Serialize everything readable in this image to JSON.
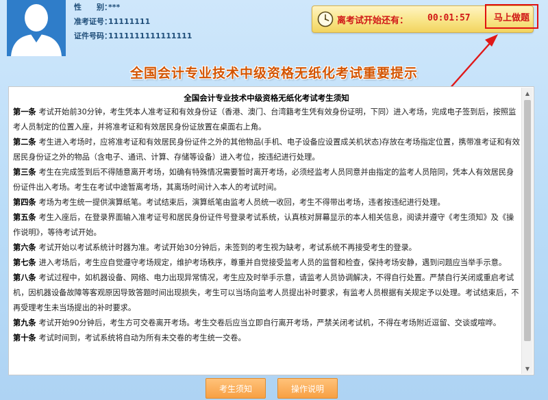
{
  "candidate": {
    "gender_label": "性　　别：",
    "gender_value": "***",
    "ticket_label": "准考证号：",
    "ticket_value": "11111111",
    "id_label": "证件号码：",
    "id_value": "1111111111111111"
  },
  "timer": {
    "label": "离考试开始还有：",
    "value": "00:01:57",
    "start_button": "马上做题",
    "icon": "clock-icon"
  },
  "banner": "全国会计专业技术中级资格无纸化考试重要提示",
  "notice": {
    "title": "全国会计专业技术中级资格无纸化考试考生须知",
    "rules": [
      {
        "head": "第一条",
        "text": "考试开始前30分钟，考生凭本人准考证和有效身份证（香港、澳门、台湾籍考生凭有效身份证明，下同）进入考场，完成电子签到后，按照监考人员制定的位置入座，并将准考证和有效居民身份证放置在桌面右上角。"
      },
      {
        "head": "第二条",
        "text": "考生进入考场时，应将准考证和有效居民身份证件之外的其他物品(手机、电子设备应设置成关机状态)存放在考场指定位置，携带准考证和有效居民身份证之外的物品（含电子、通讯、计算、存储等设备）进入考位，按违纪进行处理。"
      },
      {
        "head": "第三条",
        "text": "考生在完成签到后不得随意离开考场，如确有特殊情况需要暂时离开考场，必须经监考人员同意并由指定的监考人员陪同，凭本人有效居民身份证件出入考场。考生在考试中途暂离考场，其离场时间计入本人的考试时间。"
      },
      {
        "head": "第四条",
        "text": "考场为考生统一提供演算纸笔。考试结束后，演算纸笔由监考人员统一收回，考生不得带出考场，违者按违纪进行处理。"
      },
      {
        "head": "第五条",
        "text": "考生入座后，在登录界面输入准考证号和居民身份证件号登录考试系统，认真核对屏幕显示的本人相关信息，阅读并遵守《考生须知》及《操作说明》，等待考试开始。"
      },
      {
        "head": "第六条",
        "text": "考试开始以考试系统计时器为准。考试开始30分钟后，未签到的考生视为缺考，考试系统不再接受考生的登录。"
      },
      {
        "head": "第七条",
        "text": "进入考场后，考生应自觉遵守考场规定，维护考场秩序，尊重并自觉接受监考人员的监督和检查，保持考场安静，遇到问题应当举手示意。"
      },
      {
        "head": "第八条",
        "text": "考试过程中，如机器设备、网络、电力出现异常情况，考生应及时举手示意，请监考人员协调解决，不得自行处置。严禁自行关闭或重启考试机，因机器设备故障等客观原因导致答题时间出现损失，考生可以当场向监考人员提出补时要求，有监考人员根据有关规定予以处理。考试结束后，不再受理考生未当场提出的补时要求。"
      },
      {
        "head": "第九条",
        "text": "考试开始90分钟后，考生方可交卷离开考场。考生交卷后应当立即自行离开考场，严禁关闭考试机，不得在考场附近逗留、交谈或喧哗。"
      },
      {
        "head": "第十条",
        "text": "考试时间到，考试系统将自动为所有未交卷的考生统一交卷。"
      }
    ]
  },
  "buttons": {
    "notice": "考生须知",
    "manual": "操作说明"
  },
  "colors": {
    "accent_red": "#d01818",
    "banner_orange": "#d35400",
    "button_orange": "#f7a043",
    "background_blue": "#b9dcf8"
  }
}
